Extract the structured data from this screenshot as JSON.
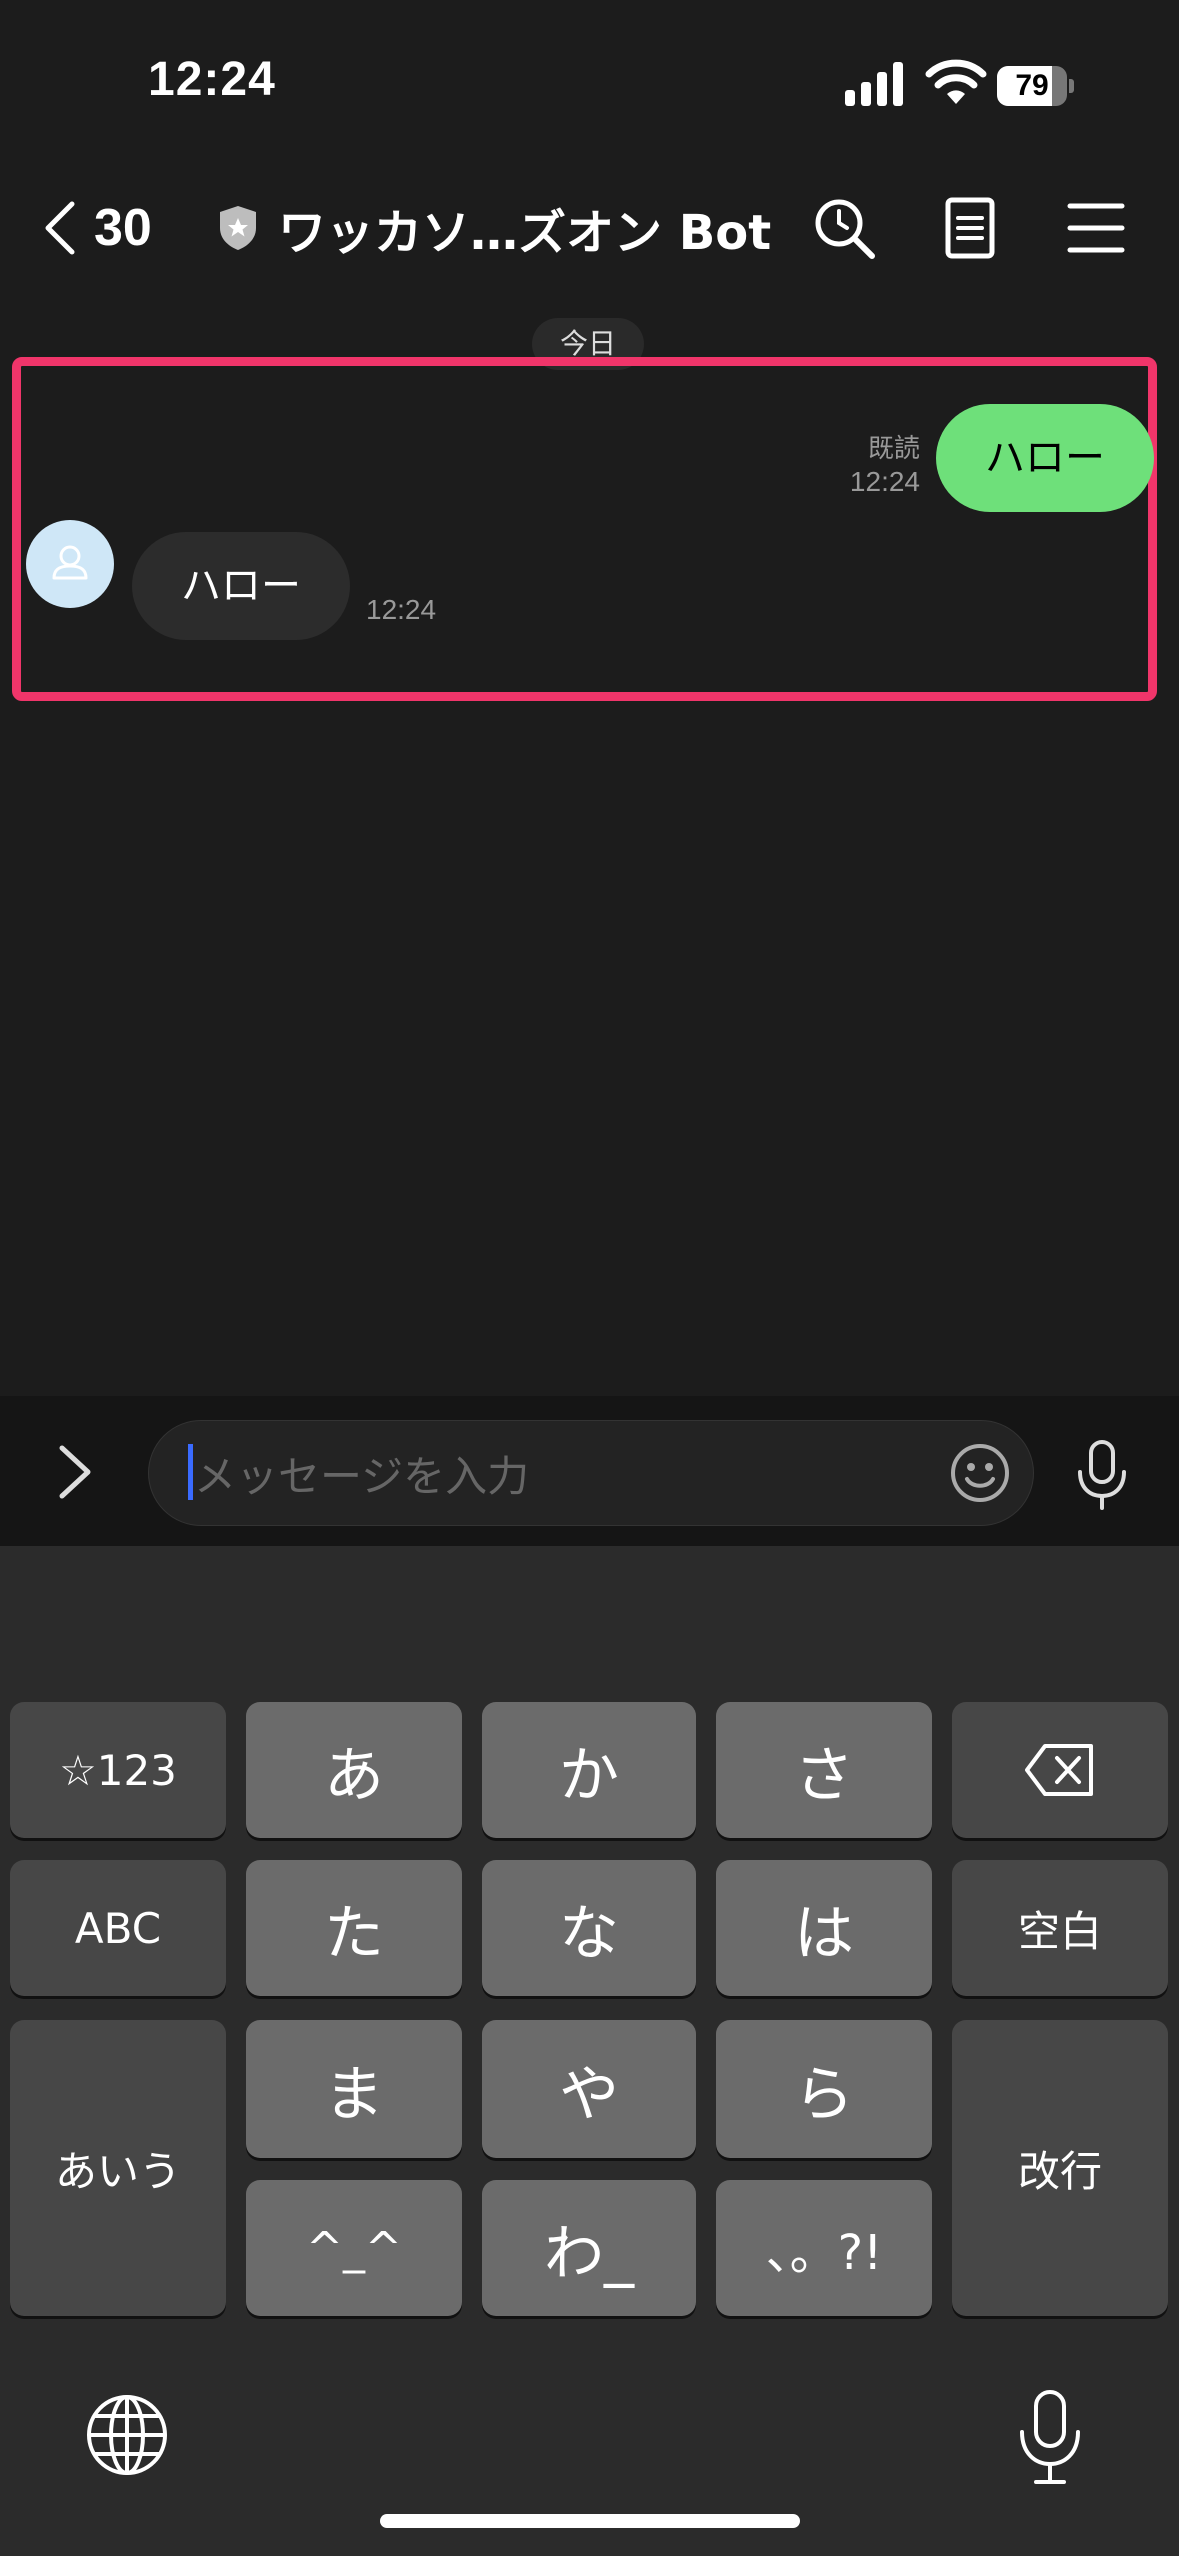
{
  "status_bar": {
    "time": "12:24",
    "battery": "79",
    "battery_fraction": 0.79
  },
  "header": {
    "back_count": "30",
    "title": "ワッカソ…ズオン Bot"
  },
  "chat": {
    "date_label": "今日",
    "sent": {
      "text": "ハロー",
      "read_label": "既読",
      "time": "12:24"
    },
    "received": {
      "text": "ハロー",
      "time": "12:24"
    }
  },
  "input": {
    "placeholder": "メッセージを入力"
  },
  "keyboard": {
    "row1": [
      "☆123",
      "あ",
      "か",
      "さ"
    ],
    "row2": [
      "ABC",
      "た",
      "な",
      "は",
      "空白"
    ],
    "row3": [
      "ま",
      "や",
      "ら"
    ],
    "row4": [
      "^_^",
      "わ_",
      "、。?!"
    ],
    "left_tall": "あいう",
    "right_tall": "改行"
  },
  "colors": {
    "sent_bubble": "#6ee07a",
    "highlight": "#f0356a",
    "caret": "#3a6bff"
  },
  "icons": [
    "back-chevron-icon",
    "shield-icon",
    "search-icon",
    "note-icon",
    "menu-icon",
    "avatar-icon",
    "chevron-right-icon",
    "emoji-icon",
    "microphone-icon",
    "backspace-icon",
    "globe-icon"
  ]
}
